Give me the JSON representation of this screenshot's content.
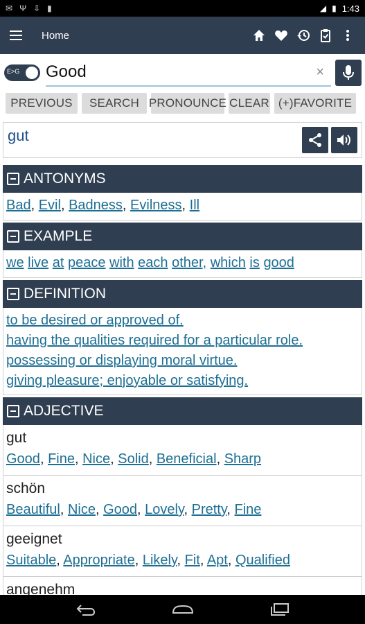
{
  "status_bar": {
    "time": "1:43"
  },
  "app_bar": {
    "title": "Home",
    "actions": [
      "home-icon",
      "heart-icon",
      "history-icon",
      "clipboard-icon",
      "more-vert-icon"
    ]
  },
  "search": {
    "toggle_label": "E>G",
    "value": "Good",
    "clear_symbol": "×"
  },
  "buttons": {
    "previous": "PREVIOUS",
    "search": "SEARCH",
    "pronounce": "PRONOUNCE",
    "clear": "CLEAR",
    "favorite": "(+)FAVORITE"
  },
  "result": {
    "word": "gut"
  },
  "sections": {
    "antonyms": {
      "title": "ANTONYMS",
      "items": [
        "Bad",
        "Evil",
        "Badness",
        "Evilness",
        "Ill"
      ]
    },
    "example": {
      "title": "EXAMPLE",
      "words": [
        "we",
        "live",
        "at",
        "peace",
        "with",
        "each",
        "other,",
        "which",
        "is",
        "good"
      ]
    },
    "definition": {
      "title": "DEFINITION",
      "lines": [
        "to be desired or approved of.",
        "having the qualities required for a particular role.",
        "possessing or displaying moral virtue.",
        "giving pleasure; enjoyable or satisfying."
      ]
    },
    "adjective": {
      "title": "ADJECTIVE",
      "entries": [
        {
          "word": "gut",
          "synonyms": [
            "Good",
            "Fine",
            "Nice",
            "Solid",
            "Beneficial",
            "Sharp"
          ]
        },
        {
          "word": "schön",
          "synonyms": [
            "Beautiful",
            "Nice",
            "Good",
            "Lovely",
            "Pretty",
            "Fine"
          ]
        },
        {
          "word": "geeignet",
          "synonyms": [
            "Suitable",
            "Appropriate",
            "Likely",
            "Fit",
            "Apt",
            "Qualified"
          ]
        },
        {
          "word": "angenehm",
          "synonyms": []
        }
      ]
    }
  }
}
